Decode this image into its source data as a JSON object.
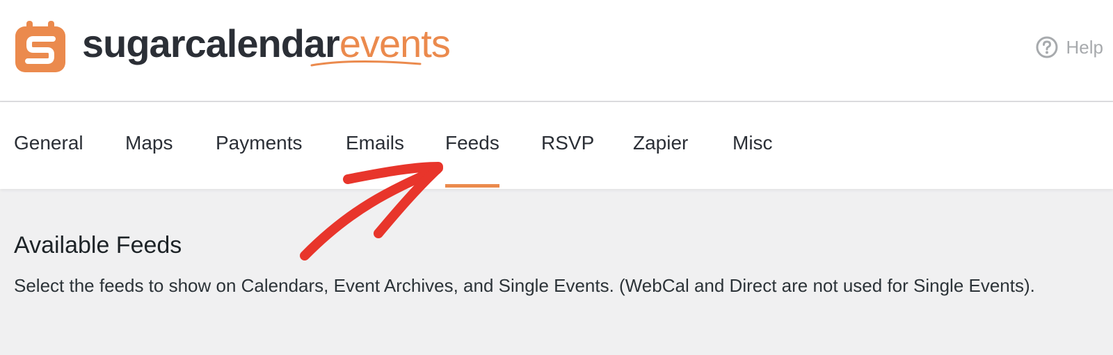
{
  "header": {
    "logo_word_dark": "sugarcalendar",
    "logo_word_accent": "events",
    "help_label": "Help"
  },
  "tabs": [
    {
      "label": "General",
      "active": false
    },
    {
      "label": "Maps",
      "active": false
    },
    {
      "label": "Payments",
      "active": false
    },
    {
      "label": "Emails",
      "active": false
    },
    {
      "label": "Feeds",
      "active": true
    },
    {
      "label": "RSVP",
      "active": false
    },
    {
      "label": "Zapier",
      "active": false
    },
    {
      "label": "Misc",
      "active": false
    }
  ],
  "content": {
    "title": "Available Feeds",
    "description": "Select the feeds to show on Calendars, Event Archives, and Single Events. (WebCal and Direct are not used for Single Events)."
  },
  "colors": {
    "accent": "#eb8a4d",
    "annotation_arrow": "#e8352b",
    "text_dark": "#2b2f36",
    "page_bg": "#f0f0f1"
  },
  "icons": {
    "logo": "sugar-calendar-s-icon",
    "help": "question-circle-icon"
  }
}
